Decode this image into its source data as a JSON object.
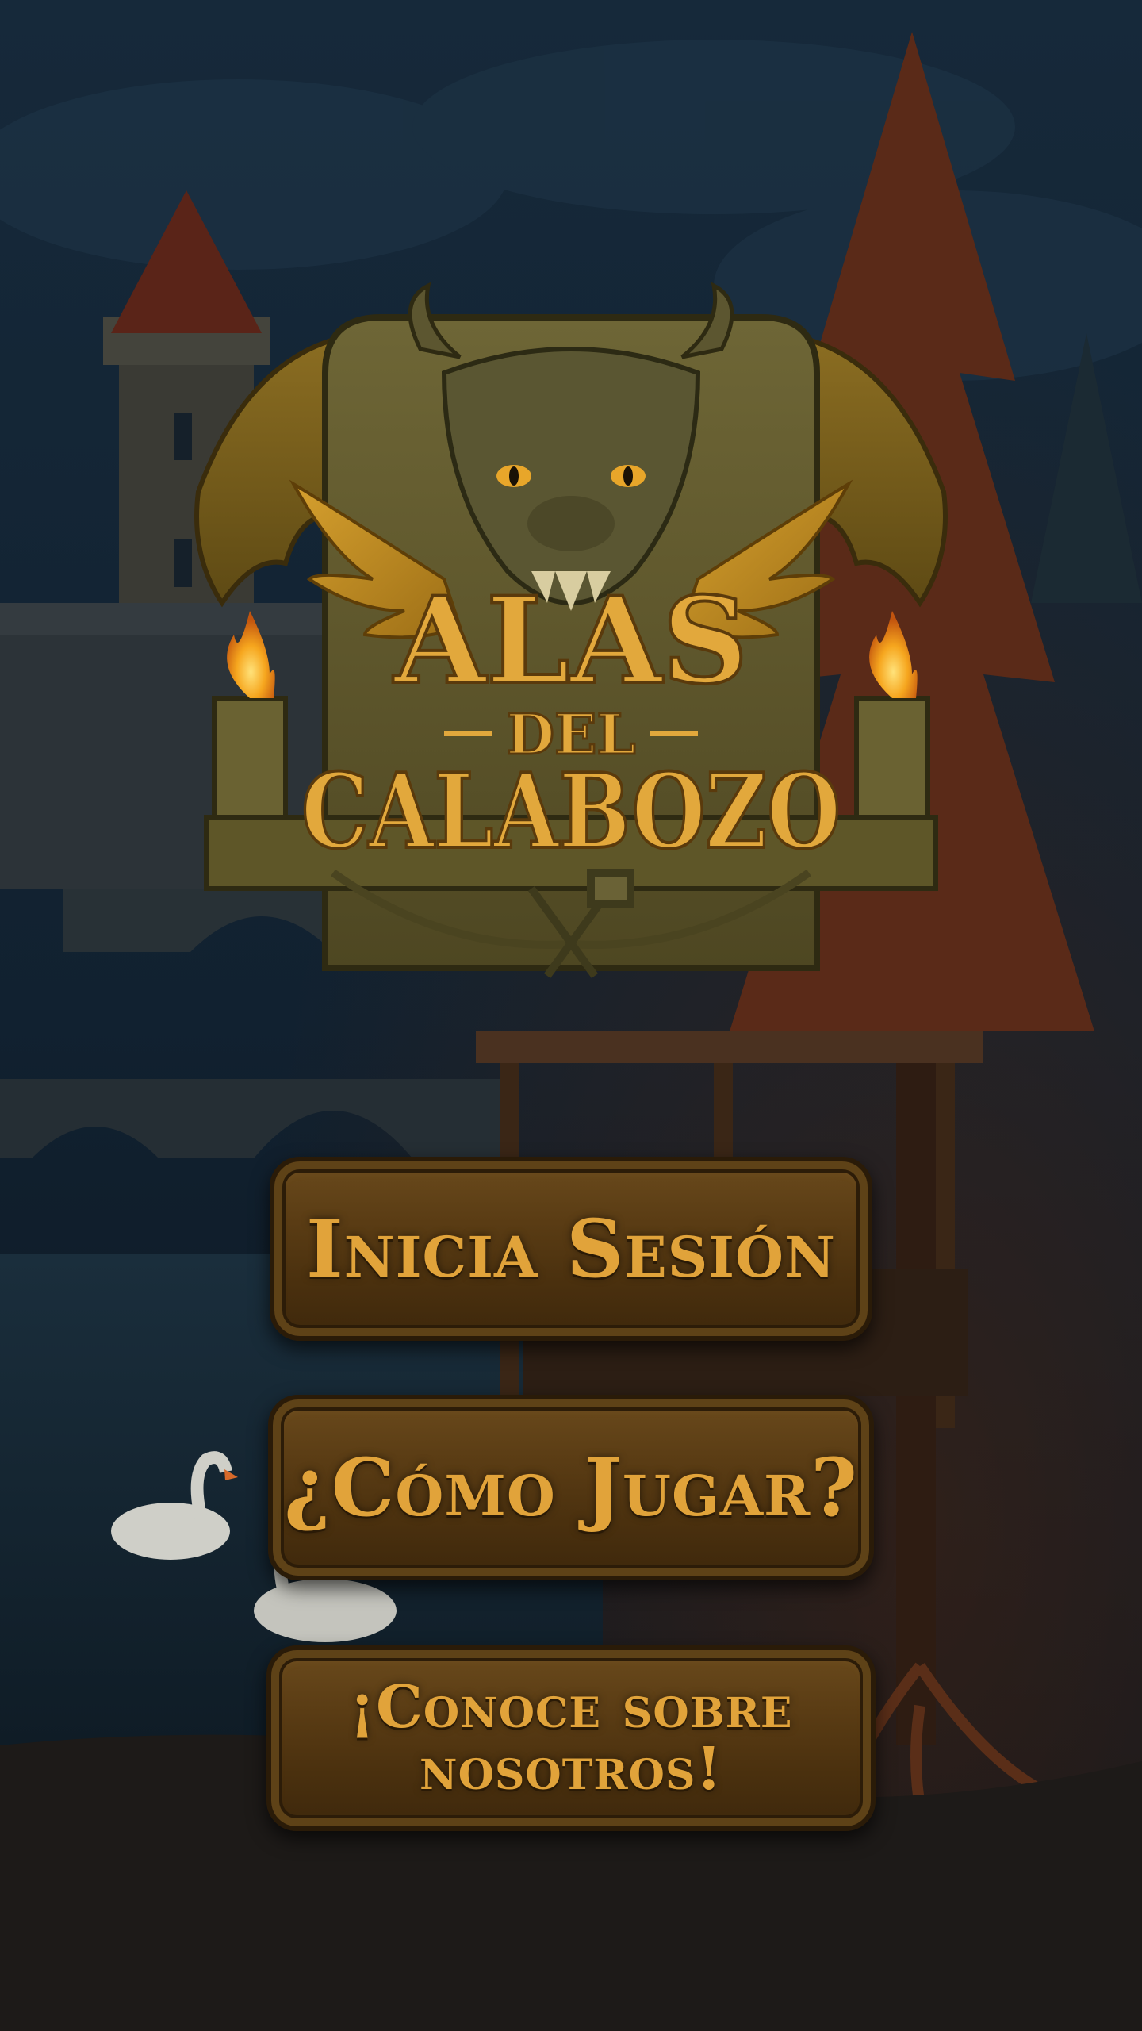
{
  "logo": {
    "title_line1": "ALAS",
    "title_line2": "DEL",
    "title_line3": "CALABOZO"
  },
  "menu": {
    "login_label": "Inicia Sesión",
    "how_to_play_label": "¿Cómo Jugar?",
    "about_label": "¡Conoce sobre nosotros!"
  },
  "colors": {
    "title_gold": "#e2a83c",
    "button_wood": "#5a3c14",
    "button_text": "#e1a33a",
    "torch_flame": "#f4a21c",
    "night_sky": "#142533"
  }
}
